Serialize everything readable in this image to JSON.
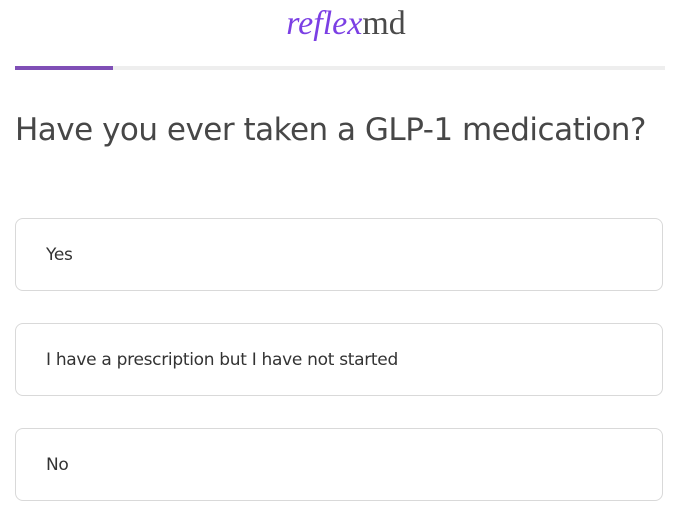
{
  "header": {
    "logo_italic": "reflex",
    "logo_plain": "md",
    "brand_color": "#7b3fe4"
  },
  "progress": {
    "fraction": 0.15,
    "fill_color": "#7f4fb6"
  },
  "question": {
    "text": "Have you ever taken a GLP-1 medication?"
  },
  "options": [
    {
      "label": "Yes"
    },
    {
      "label": "I have a prescription but I have not started"
    },
    {
      "label": "No"
    }
  ]
}
